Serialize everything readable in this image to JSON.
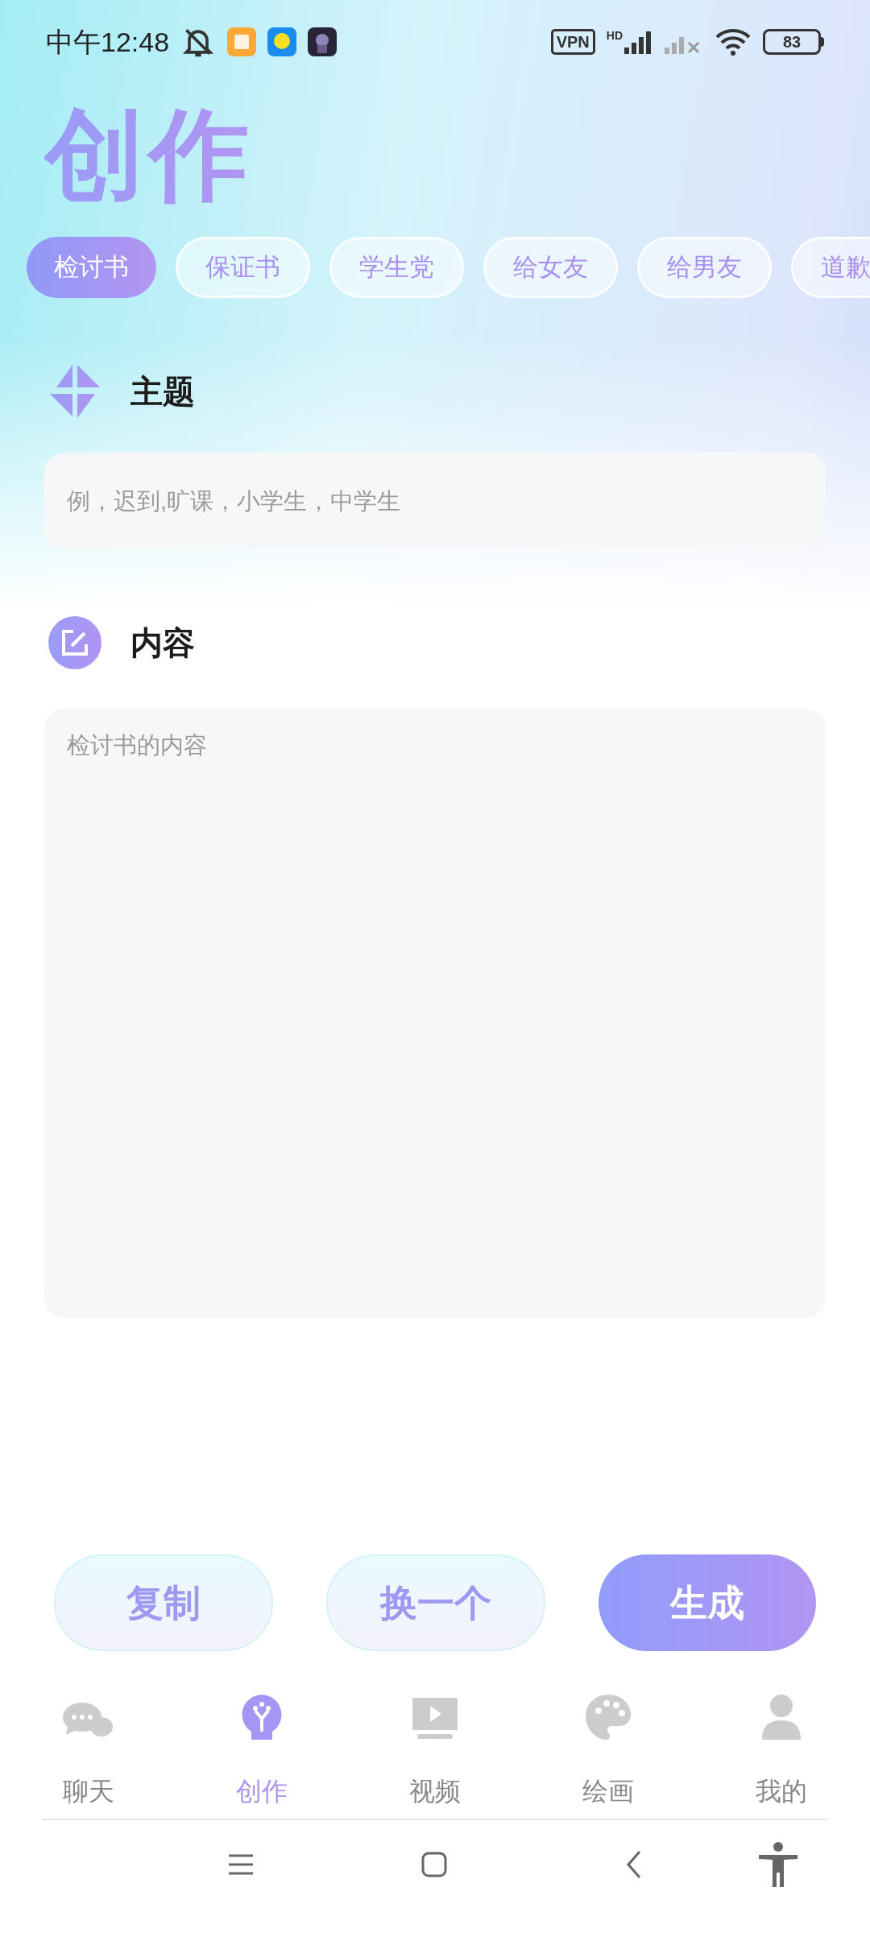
{
  "status_bar": {
    "time": "中午12:48",
    "vpn": "VPN",
    "hd": "HD",
    "battery": "83"
  },
  "header": {
    "title": "创作"
  },
  "tabs": [
    {
      "label": "检讨书",
      "selected": true
    },
    {
      "label": "保证书",
      "selected": false
    },
    {
      "label": "学生党",
      "selected": false
    },
    {
      "label": "给女友",
      "selected": false
    },
    {
      "label": "给男友",
      "selected": false
    },
    {
      "label": "道歉",
      "selected": false
    }
  ],
  "topic": {
    "heading": "主题",
    "placeholder": "例，迟到,旷课，小学生，中学生"
  },
  "content": {
    "heading": "内容",
    "placeholder": "检讨书的内容"
  },
  "actions": [
    {
      "label": "复制",
      "kind": "secondary"
    },
    {
      "label": "换一个",
      "kind": "secondary"
    },
    {
      "label": "生成",
      "kind": "primary"
    }
  ],
  "nav": [
    {
      "label": "聊天",
      "kind": "chat",
      "selected": false
    },
    {
      "label": "创作",
      "kind": "create",
      "selected": true
    },
    {
      "label": "视频",
      "kind": "video",
      "selected": false
    },
    {
      "label": "绘画",
      "kind": "paint",
      "selected": false
    },
    {
      "label": "我的",
      "kind": "profile",
      "selected": false
    }
  ]
}
